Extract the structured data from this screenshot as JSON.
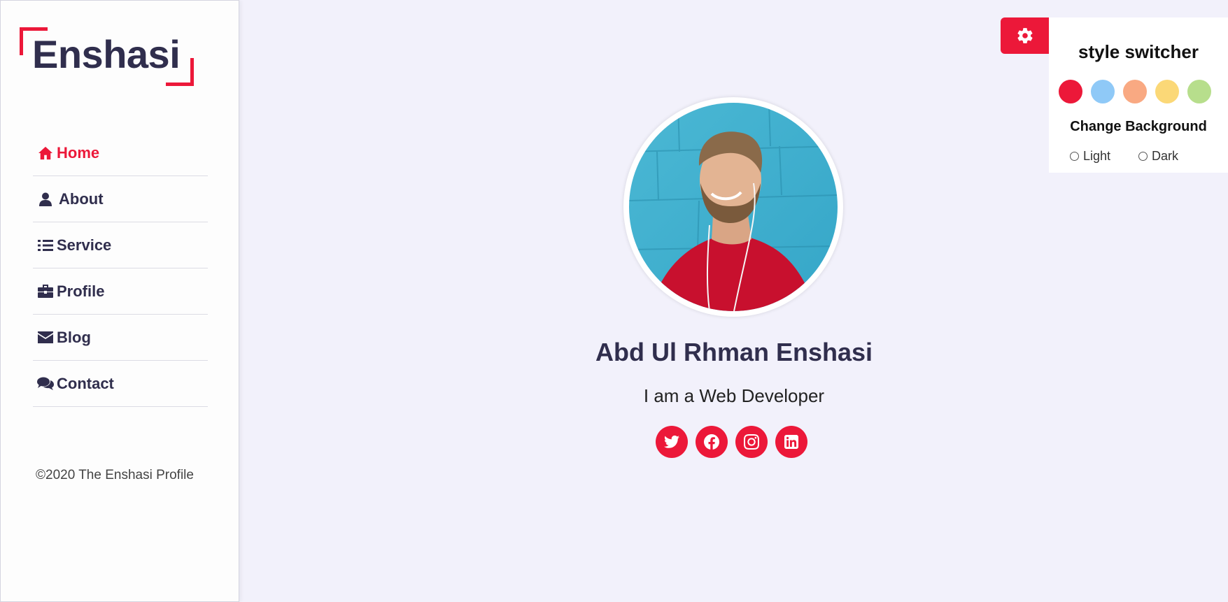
{
  "brand": {
    "logo_text": "Enshasi",
    "accent_color": "#ec1839"
  },
  "nav": {
    "items": [
      {
        "label": "Home",
        "icon": "home-icon",
        "active": true
      },
      {
        "label": "About",
        "icon": "user-icon",
        "active": false
      },
      {
        "label": "Service",
        "icon": "list-icon",
        "active": false
      },
      {
        "label": "Profile",
        "icon": "briefcase-icon",
        "active": false
      },
      {
        "label": "Blog",
        "icon": "envelope-icon",
        "active": false
      },
      {
        "label": "Contact",
        "icon": "comments-icon",
        "active": false
      }
    ]
  },
  "footer": {
    "text": "©2020 The Enshasi Profile"
  },
  "hero": {
    "name": "Abd Ul Rhman Enshasi",
    "tagline": "I am a Web Developer",
    "socials": [
      {
        "icon": "twitter-icon"
      },
      {
        "icon": "facebook-icon"
      },
      {
        "icon": "instagram-icon"
      },
      {
        "icon": "linkedin-icon"
      }
    ]
  },
  "style_switcher": {
    "title": "style switcher",
    "toggle_icon": "gear-icon",
    "colors": [
      "#ec1839",
      "#8fc9f7",
      "#f9a982",
      "#fbd877",
      "#b7de8c"
    ],
    "background_title": "Change Background",
    "options": [
      {
        "label": "Light"
      },
      {
        "label": "Dark"
      }
    ]
  }
}
